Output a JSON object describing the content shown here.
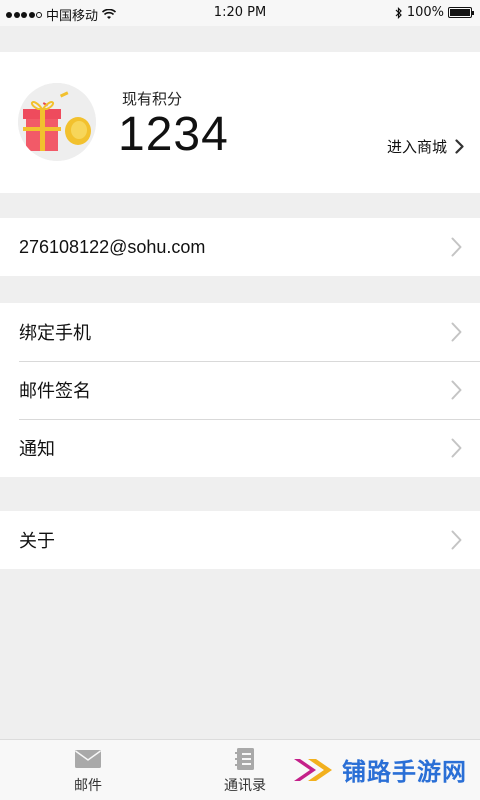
{
  "status_bar": {
    "carrier": "中国移动",
    "time": "1:20 PM",
    "battery_text": "100%",
    "battery_level": 1.0
  },
  "points": {
    "label": "现有积分",
    "value": "1234",
    "mall_link": "进入商城"
  },
  "account": {
    "email": "276108122@sohu.com"
  },
  "settings": {
    "items": [
      {
        "label": "绑定手机"
      },
      {
        "label": "邮件签名"
      },
      {
        "label": "通知"
      }
    ]
  },
  "about": {
    "label": "关于"
  },
  "tab_bar": {
    "mail": "邮件",
    "contacts": "通讯录"
  },
  "watermark": {
    "text": "铺路手游网"
  },
  "colors": {
    "background": "#efefef",
    "card": "#ffffff",
    "chevron": "#c4c4c4",
    "watermark_blue": "#2a6fd6"
  },
  "icons": {
    "avatar": "gift-box-icon",
    "mall": "chevron-right-icon",
    "row": "chevron-right-icon",
    "mail_tab": "envelope-icon",
    "contacts_tab": "address-book-icon",
    "bluetooth": "bluetooth-icon",
    "wifi": "wifi-icon"
  }
}
